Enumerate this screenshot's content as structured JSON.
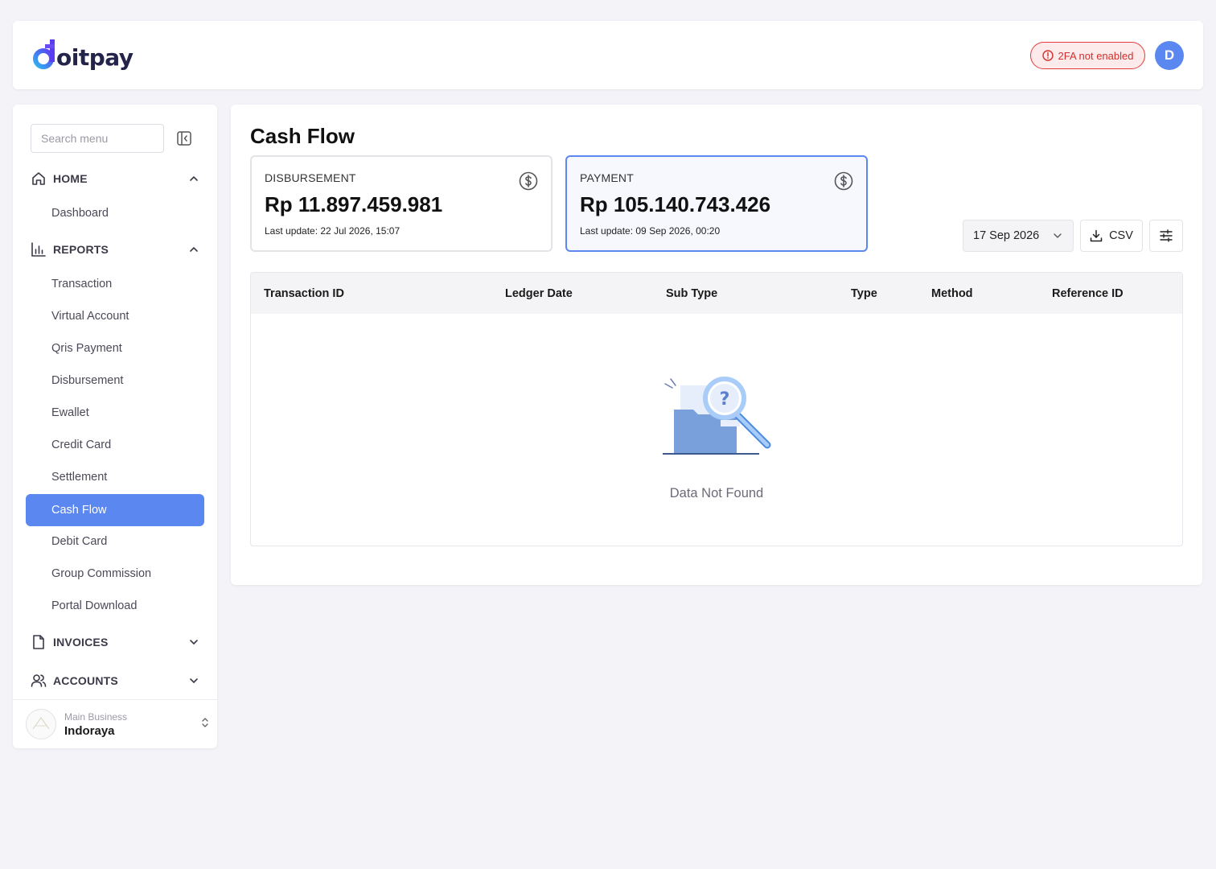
{
  "header": {
    "brand": "oitpay",
    "twofa_badge": "2FA not enabled",
    "user_initial": "D"
  },
  "sidebar": {
    "search_placeholder": "Search menu",
    "sections": {
      "home": {
        "label": "HOME",
        "items": [
          "Dashboard"
        ]
      },
      "reports": {
        "label": "REPORTS",
        "items": [
          "Transaction",
          "Virtual Account",
          "Qris Payment",
          "Disbursement",
          "Ewallet",
          "Credit Card",
          "Settlement",
          "Cash Flow",
          "Debit Card",
          "Group Commission",
          "Portal Download"
        ]
      },
      "invoices": {
        "label": "INVOICES"
      },
      "accounts": {
        "label": "ACCOUNTS"
      }
    },
    "active_item": "Cash Flow",
    "business": {
      "caption": "Main Business",
      "name": "Indoraya"
    }
  },
  "main": {
    "title": "Cash Flow",
    "cards": [
      {
        "label": "DISBURSEMENT",
        "amount": "Rp 11.897.459.981",
        "updated": "Last update: 22 Jul 2026, 15:07"
      },
      {
        "label": "PAYMENT",
        "amount": "Rp 105.140.743.426",
        "updated": "Last update: 09 Sep 2026, 00:20"
      }
    ],
    "date_filter": "17 Sep 2026",
    "csv_label": "CSV",
    "table": {
      "columns": [
        "Transaction ID",
        "Ledger Date",
        "Sub Type",
        "Type",
        "Method",
        "Reference ID"
      ],
      "empty_text": "Data Not Found"
    }
  },
  "colors": {
    "accent": "#5b87f0",
    "danger": "#e23b3b",
    "background": "#f3f3f8"
  }
}
